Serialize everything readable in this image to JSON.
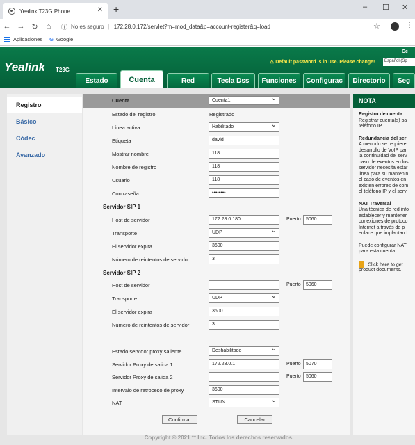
{
  "browser": {
    "tab_title": "Yealink T23G Phone",
    "security": "No es seguro",
    "url": "172.28.0.172/servlet?m=mod_data&p=account-register&q=load",
    "bookmarks": [
      "Aplicaciones",
      "Google"
    ]
  },
  "header": {
    "logo": "Yealink",
    "model": "T23G",
    "corner": "Ce",
    "warning": "Default password is in use. Please change!",
    "language": "Español (Sp"
  },
  "nav_tabs": [
    "Estado",
    "Cuenta",
    "Red",
    "Tecla Dss",
    "Funciones",
    "Configurac",
    "Directorio",
    "Seg"
  ],
  "active_tab": "Cuenta",
  "sidebar": [
    "Registro",
    "Básico",
    "Códec",
    "Avanzado"
  ],
  "form": {
    "cuenta_label": "Cuenta",
    "cuenta_value": "Cuenta1",
    "estado_label": "Estado del registro",
    "estado_value": "Registrado",
    "linea_label": "Línea activa",
    "linea_value": "Habilitado",
    "etiqueta_label": "Etiqueta",
    "etiqueta_value": "david",
    "mostrar_label": "Mostrar nombre",
    "mostrar_value": "118",
    "nombre_reg_label": "Nombre de registro",
    "nombre_reg_value": "118",
    "usuario_label": "Usuario",
    "usuario_value": "118",
    "pass_label": "Contraseña",
    "pass_value": "••••••••",
    "sip1_title": "Servidor SIP 1",
    "sip1_host_label": "Host de servidor",
    "sip1_host_value": "172.28.0.180",
    "sip1_port_label": "Puerto",
    "sip1_port_value": "5060",
    "sip1_transport_label": "Transporte",
    "sip1_transport_value": "UDP",
    "sip1_expira_label": "El servidor expira",
    "sip1_expira_value": "3600",
    "sip1_retry_label": "Número de reintentos de servidor",
    "sip1_retry_value": "3",
    "sip2_title": "Servidor SIP 2",
    "sip2_host_label": "Host de servidor",
    "sip2_host_value": "",
    "sip2_port_label": "Puerto",
    "sip2_port_value": "5060",
    "sip2_transport_label": "Transporte",
    "sip2_transport_value": "UDP",
    "sip2_expira_label": "El servidor expira",
    "sip2_expira_value": "3600",
    "sip2_retry_label": "Número de reintentos de servidor",
    "sip2_retry_value": "3",
    "proxy_state_label": "Estado servidor proxy saliente",
    "proxy_state_value": "Deshabilitado",
    "proxy1_label": "Servidor Proxy de salida 1",
    "proxy1_value": "172.28.0.1",
    "proxy1_port_label": "Puerto",
    "proxy1_port_value": "5070",
    "proxy2_label": "Servidor Proxy de salida 2",
    "proxy2_value": "",
    "proxy2_port_label": "Puerto",
    "proxy2_port_value": "5060",
    "backoff_label": "Intervalo de retroceso de proxy",
    "backoff_value": "3600",
    "nat_label": "NAT",
    "nat_value": "STUN",
    "confirm": "Confirmar",
    "cancel": "Cancelar"
  },
  "note": {
    "title": "NOTA",
    "h1": "Registro de cuenta",
    "p1": [
      "Registrar cuenta(s) pa",
      "teléfono IP."
    ],
    "h2": "Redundancia del ser",
    "p2": [
      "A menudo se requiere",
      "desarrollo de VoIP par",
      "la continuidad del serv",
      "caso de eventos en los",
      "servidor necesita estar",
      "línea para su mantenin",
      "el caso de eventos en",
      "existen errores de com",
      "el teléfono IP y el serv"
    ],
    "h3": "NAT Traversal",
    "p3": [
      "Una técnica de red info",
      "establecer y mantener",
      "conexiones de protoco",
      "Internet a través de p",
      "enlace que implantan l"
    ],
    "p4": [
      "Puede configurar NAT",
      "para esta cuenta."
    ],
    "link": [
      "Click here to get",
      "product documents."
    ]
  },
  "footer": "Copyright © 2021 ** Inc. Todos los derechos reservados."
}
